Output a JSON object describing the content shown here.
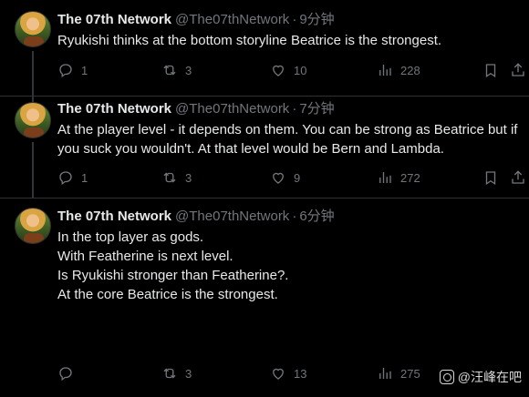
{
  "colors": {
    "background": "#000000",
    "text": "#e7e9ea",
    "muted": "#71767b",
    "separator": "#2f3336"
  },
  "tweets": [
    {
      "author_name": "The 07th Network",
      "handle": "@The07thNetwork",
      "dot": "·",
      "time": "9分钟",
      "paragraphs": [
        "Ryukishi thinks at the bottom storyline Beatrice is the strongest."
      ],
      "replies": "1",
      "retweets": "3",
      "likes": "10",
      "views": "228"
    },
    {
      "author_name": "The 07th Network",
      "handle": "@The07thNetwork",
      "dot": "·",
      "time": "7分钟",
      "paragraphs": [
        "At the player level - it depends on them. You can be strong as Beatrice but if you suck you wouldn't. At that level would be Bern and Lambda."
      ],
      "replies": "1",
      "retweets": "3",
      "likes": "9",
      "views": "272"
    },
    {
      "author_name": "The 07th Network",
      "handle": "@The07thNetwork",
      "dot": "·",
      "time": "6分钟",
      "paragraphs": [
        "In the top layer as gods.",
        "With Featherine is next level.",
        "Is Ryukishi stronger than Featherine?.",
        "At the core Beatrice is the strongest."
      ],
      "replies": "",
      "retweets": "3",
      "likes": "13",
      "views": "275"
    }
  ],
  "icons": {
    "reply": "reply-icon",
    "retweet": "retweet-icon",
    "like": "heart-icon",
    "views": "views-icon",
    "bookmark": "bookmark-icon",
    "share": "share-icon"
  },
  "watermark": {
    "text": "@汪峰在吧"
  }
}
